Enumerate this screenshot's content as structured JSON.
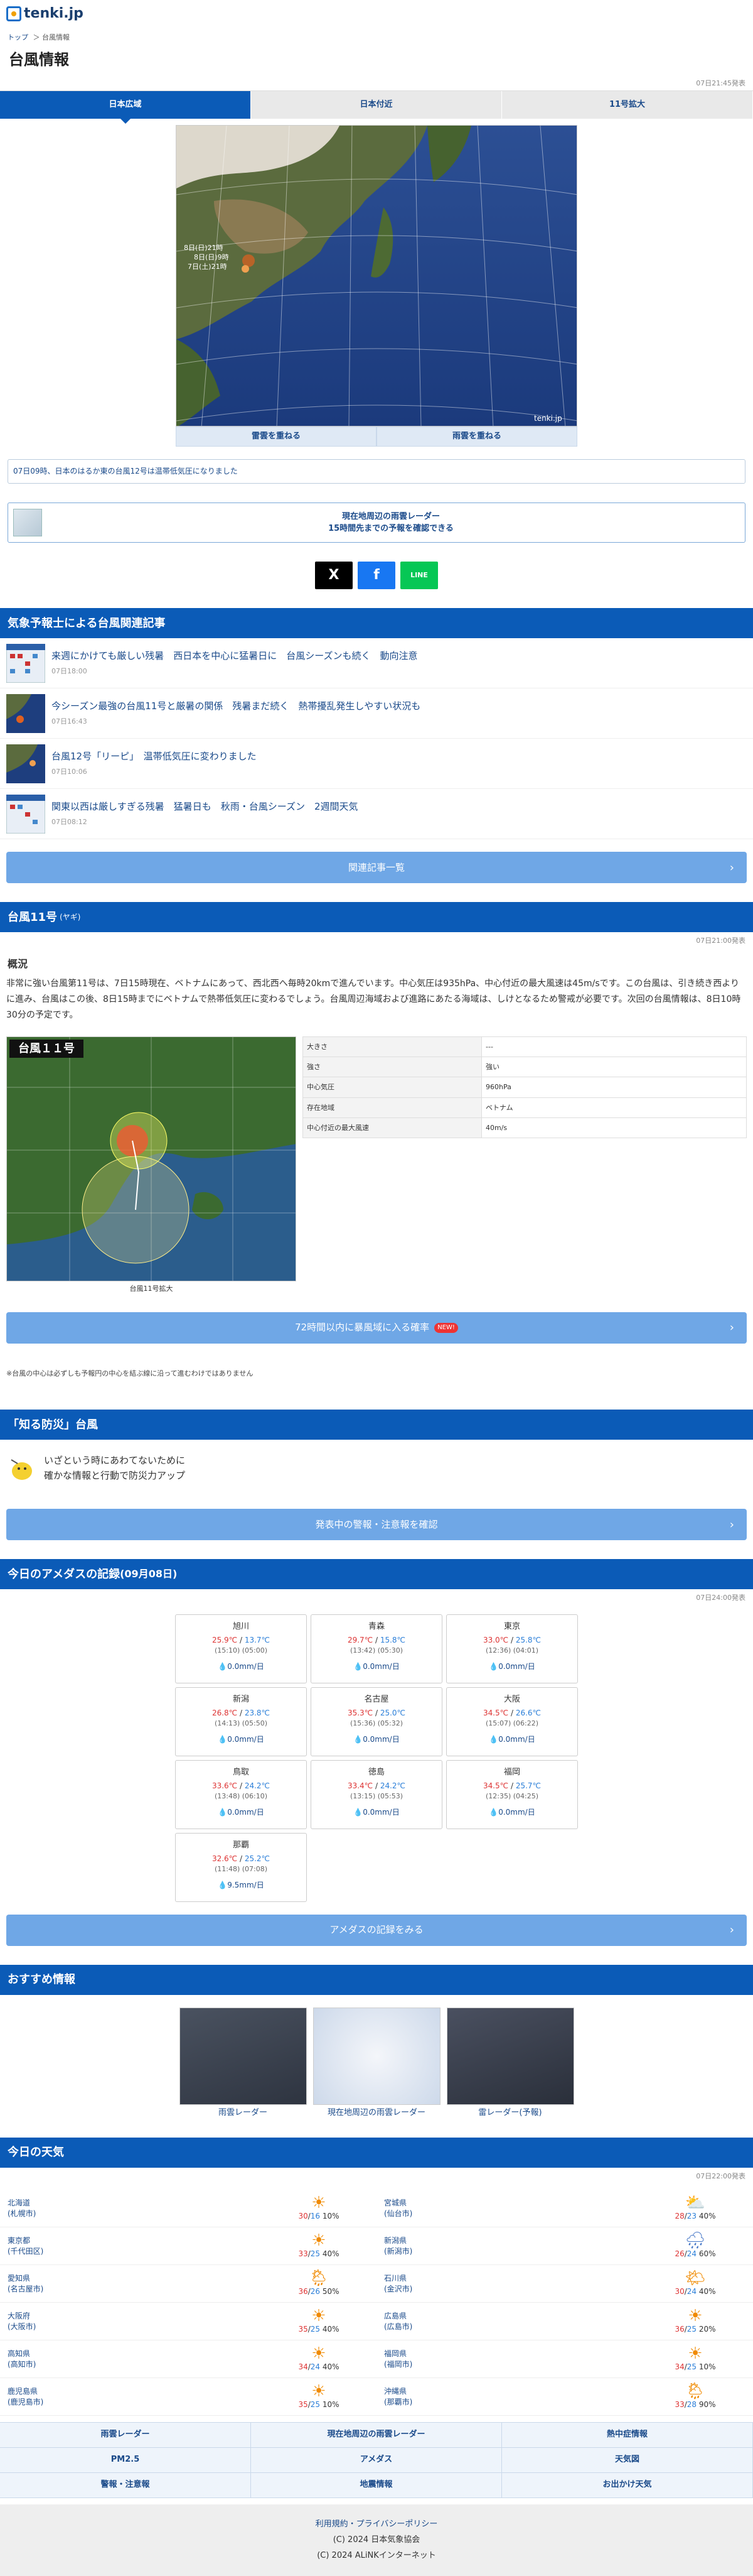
{
  "site": {
    "logo": "tenki.jp"
  },
  "breadcrumb": [
    "トップ",
    "＞ 台風情報"
  ],
  "page_title": "台風情報",
  "updated": "07日21:45発表",
  "tabs": [
    "日本広域",
    "日本付近",
    "11号拡大"
  ],
  "map": {
    "labels": [
      "8日(日)21時",
      "8日(日)9時",
      "7日(土)21時"
    ],
    "overlay_buttons": [
      "雷雲を重ねる",
      "雨雲を重ねる"
    ],
    "watermark": "tenki.jp"
  },
  "notice": "07日09時、日本のはるか東の台風12号は温帯低気圧になりました",
  "radar_promo": {
    "line1": "現在地周辺の雨雲レーダー",
    "line2": "15時間先までの予報を確認できる"
  },
  "share": [
    "X",
    "f",
    "LINE"
  ],
  "articles": {
    "title": "気象予報士による台風関連記事",
    "items": [
      {
        "title": "来週にかけても厳しい残暑　西日本を中心に猛暑日に　台風シーズンも続く　動向注意",
        "date": "07日18:00"
      },
      {
        "title": "今シーズン最強の台風11号と厳暑の関係　残暑まだ続く　熱帯擾乱発生しやすい状況も",
        "date": "07日16:43"
      },
      {
        "title": "台風12号「リーピ」　温帯低気圧に変わりました",
        "date": "07日10:06"
      },
      {
        "title": "関東以西は厳しすぎる残暑　猛暑日も　秋雨・台風シーズン　2週間天気",
        "date": "07日08:12"
      }
    ],
    "more": "関連記事一覧"
  },
  "typhoon": {
    "title": "台風11号",
    "name": "(ヤギ)",
    "updated": "07日21:00発表",
    "gaiyo_label": "概況",
    "text": "非常に強い台風第11号は、7日15時現在、ベトナムにあって、西北西へ毎時20kmで進んでいます。中心気圧は935hPa、中心付近の最大風速は45m/sです。この台風は、引き続き西よりに進み、台風はこの後、8日15時までにベトナムで熱帯低気圧に変わるでしょう。台風周辺海域および進路にあたる海域は、しけとなるため警戒が必要です。次回の台風情報は、8日10時30分の予定です。",
    "map_label": "台風１１号",
    "map_caption": "台風11号拡大",
    "props": [
      {
        "k": "大きさ",
        "v": "---"
      },
      {
        "k": "強さ",
        "v": "強い"
      },
      {
        "k": "中心気圧",
        "v": "960hPa"
      },
      {
        "k": "存在地域",
        "v": "ベトナム"
      },
      {
        "k": "中心付近の最大風速",
        "v": "40m/s"
      }
    ],
    "prob_button": "72時間以内に暴風域に入る確率",
    "prob_badge": "NEW!",
    "note": "※台風の中心は必ずしも予報円の中心を結ぶ線に沿って進むわけではありません"
  },
  "bosai": {
    "title": "「知る防災」台風",
    "text1": "いざという時にあわてないために",
    "text2": "確かな情報と行動で防災力アップ",
    "button": "発表中の警報・注意報を確認"
  },
  "amedas": {
    "title": "今日のアメダスの記録",
    "date": "(09月08日)",
    "updated": "07日24:00発表",
    "button": "アメダスの記録をみる",
    "cells": [
      {
        "city": "旭川",
        "hi": "25.9℃",
        "lo": "13.7℃",
        "ht": "(15:10)",
        "lt": "(05:00)",
        "rain": "0.0mm/日"
      },
      {
        "city": "青森",
        "hi": "29.7℃",
        "lo": "15.8℃",
        "ht": "(13:42)",
        "lt": "(05:30)",
        "rain": "0.0mm/日"
      },
      {
        "city": "東京",
        "hi": "33.0℃",
        "lo": "25.8℃",
        "ht": "(12:36)",
        "lt": "(04:01)",
        "rain": "0.0mm/日"
      },
      {
        "city": "新潟",
        "hi": "26.8℃",
        "lo": "23.8℃",
        "ht": "(14:13)",
        "lt": "(05:50)",
        "rain": "0.0mm/日"
      },
      {
        "city": "名古屋",
        "hi": "35.3℃",
        "lo": "25.0℃",
        "ht": "(15:36)",
        "lt": "(05:32)",
        "rain": "0.0mm/日"
      },
      {
        "city": "大阪",
        "hi": "34.5℃",
        "lo": "26.6℃",
        "ht": "(15:07)",
        "lt": "(06:22)",
        "rain": "0.0mm/日"
      },
      {
        "city": "鳥取",
        "hi": "33.6℃",
        "lo": "24.2℃",
        "ht": "(13:48)",
        "lt": "(06:10)",
        "rain": "0.0mm/日"
      },
      {
        "city": "徳島",
        "hi": "33.4℃",
        "lo": "24.2℃",
        "ht": "(13:15)",
        "lt": "(05:53)",
        "rain": "0.0mm/日"
      },
      {
        "city": "福岡",
        "hi": "34.5℃",
        "lo": "25.7℃",
        "ht": "(12:35)",
        "lt": "(04:25)",
        "rain": "0.0mm/日"
      },
      {
        "city": "那覇",
        "hi": "32.6℃",
        "lo": "25.2℃",
        "ht": "(11:48)",
        "lt": "(07:08)",
        "rain": "9.5mm/日"
      }
    ]
  },
  "recommend": {
    "title": "おすすめ情報",
    "items": [
      "雨雲レーダー",
      "現在地周辺の雨雲レーダー",
      "雷レーダー(予報)"
    ]
  },
  "today": {
    "title": "今日の天気",
    "updated": "07日22:00発表",
    "rows": [
      {
        "city": "北海道",
        "sub": "(札幌市)",
        "hi": "30",
        "lo": "16",
        "pop": "10%",
        "icon": "sunny"
      },
      {
        "city": "宮城県",
        "sub": "(仙台市)",
        "hi": "28",
        "lo": "23",
        "pop": "40%",
        "icon": "cloudy-sunny"
      },
      {
        "city": "東京都",
        "sub": "(千代田区)",
        "hi": "33",
        "lo": "25",
        "pop": "40%",
        "icon": "sunny"
      },
      {
        "city": "新潟県",
        "sub": "(新潟市)",
        "hi": "26",
        "lo": "24",
        "pop": "60%",
        "icon": "cloudy-rain"
      },
      {
        "city": "愛知県",
        "sub": "(名古屋市)",
        "hi": "36",
        "lo": "26",
        "pop": "50%",
        "icon": "sunny-rain"
      },
      {
        "city": "石川県",
        "sub": "(金沢市)",
        "hi": "30",
        "lo": "24",
        "pop": "40%",
        "icon": "sunny-cloudy"
      },
      {
        "city": "大阪府",
        "sub": "(大阪市)",
        "hi": "35",
        "lo": "25",
        "pop": "40%",
        "icon": "sunny"
      },
      {
        "city": "広島県",
        "sub": "(広島市)",
        "hi": "36",
        "lo": "25",
        "pop": "20%",
        "icon": "sunny"
      },
      {
        "city": "高知県",
        "sub": "(高知市)",
        "hi": "34",
        "lo": "24",
        "pop": "40%",
        "icon": "sunny"
      },
      {
        "city": "福岡県",
        "sub": "(福岡市)",
        "hi": "34",
        "lo": "25",
        "pop": "10%",
        "icon": "sunny"
      },
      {
        "city": "鹿児島県",
        "sub": "(鹿児島市)",
        "hi": "35",
        "lo": "25",
        "pop": "10%",
        "icon": "sunny"
      },
      {
        "city": "沖縄県",
        "sub": "(那覇市)",
        "hi": "33",
        "lo": "28",
        "pop": "90%",
        "icon": "sunny-rain"
      }
    ]
  },
  "bottom_links": [
    "雨雲レーダー",
    "現在地周辺の雨雲レーダー",
    "熱中症情報",
    "PM2.5",
    "アメダス",
    "天気図",
    "警報・注意報",
    "地震情報",
    "お出かけ天気"
  ],
  "footer": {
    "link": "利用規約・プライバシーポリシー",
    "c1": "(C) 2024 日本気象協会",
    "c2": "(C) 2024 ALiNKインターネット"
  }
}
